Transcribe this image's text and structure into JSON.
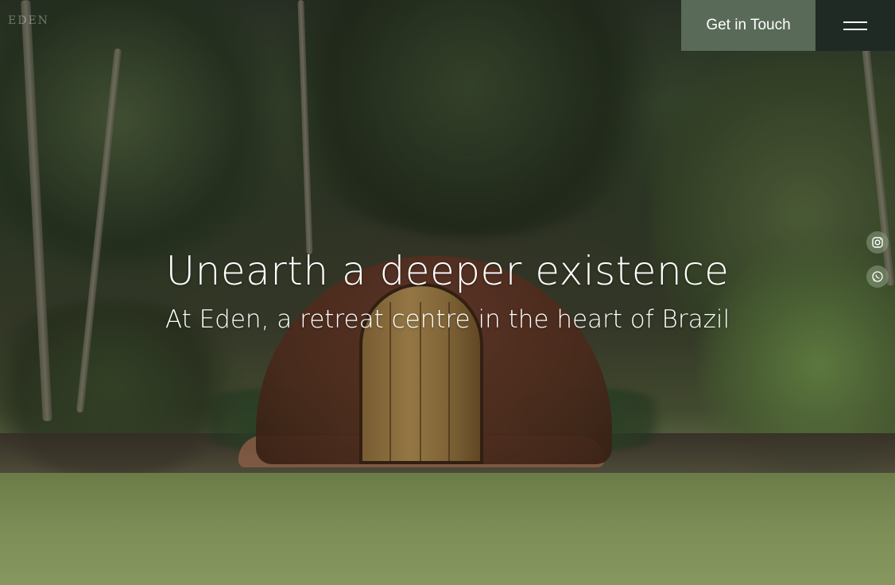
{
  "header": {
    "logo_text": "EDEN",
    "cta_label": "Get in Touch",
    "menu_icon": "hamburger-icon"
  },
  "hero": {
    "headline": "Unearth a deeper existence",
    "subline": "At Eden, a retreat centre in the heart of Brazil"
  },
  "social": [
    {
      "icon": "instagram-icon"
    },
    {
      "icon": "whatsapp-icon"
    }
  ],
  "colors": {
    "cta_bg": "#596a58",
    "menu_bg": "#1f2a25",
    "text": "#ffffff"
  }
}
